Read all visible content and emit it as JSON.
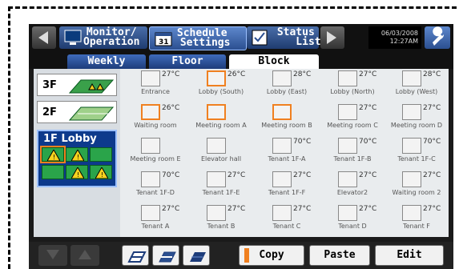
{
  "nav": {
    "monitor_label": "Monitor/\nOperation",
    "schedule_label": "Schedule\n Settings",
    "status_label": "Status\n    List",
    "date": "06/03/2008",
    "time": "12:27AM"
  },
  "view_tabs": [
    "Weekly",
    "Floor",
    "Block"
  ],
  "floors": [
    "3F",
    "2F"
  ],
  "block": {
    "label": "1F Lobby"
  },
  "units": [
    {
      "name": "Entrance",
      "temp": "27°C"
    },
    {
      "name": "Lobby (South)",
      "temp": "26°C"
    },
    {
      "name": "Lobby (East)",
      "temp": "28°C"
    },
    {
      "name": "Lobby (North)",
      "temp": "27°C"
    },
    {
      "name": "Lobby (West)",
      "temp": "28°C"
    },
    {
      "name": "Waiting room",
      "temp": "26°C"
    },
    {
      "name": "Meeting room A",
      "temp": ""
    },
    {
      "name": "Meeting room B",
      "temp": ""
    },
    {
      "name": "Meeting room C",
      "temp": "27°C"
    },
    {
      "name": "Meeting room D",
      "temp": "27°C"
    },
    {
      "name": "Meeting room E",
      "temp": ""
    },
    {
      "name": "Elevator hall",
      "temp": ""
    },
    {
      "name": "Tenant 1F-A",
      "temp": "70°C"
    },
    {
      "name": "Tenant 1F-B",
      "temp": "70°C"
    },
    {
      "name": "Tenant 1F-C",
      "temp": "70°C"
    },
    {
      "name": "Tenant 1F-D",
      "temp": "70°C"
    },
    {
      "name": "Tenant 1F-E",
      "temp": "27°C"
    },
    {
      "name": "Tenant 1F-F",
      "temp": "27°C"
    },
    {
      "name": "Elevator2",
      "temp": "27°C"
    },
    {
      "name": "Waiting room 2",
      "temp": "27°C"
    },
    {
      "name": "Tenant A",
      "temp": "27°C"
    },
    {
      "name": "Tenant B",
      "temp": "27°C"
    },
    {
      "name": "Tenant C",
      "temp": "27°C"
    },
    {
      "name": "Tenant D",
      "temp": "27°C"
    },
    {
      "name": "Tenant F",
      "temp": "27°C"
    }
  ],
  "actions": {
    "copy": "Copy",
    "paste": "Paste",
    "edit": "Edit"
  },
  "colors": {
    "accent": "#f08020",
    "tab_blue": "#2b4f90",
    "block_green": "#2aa44a"
  }
}
